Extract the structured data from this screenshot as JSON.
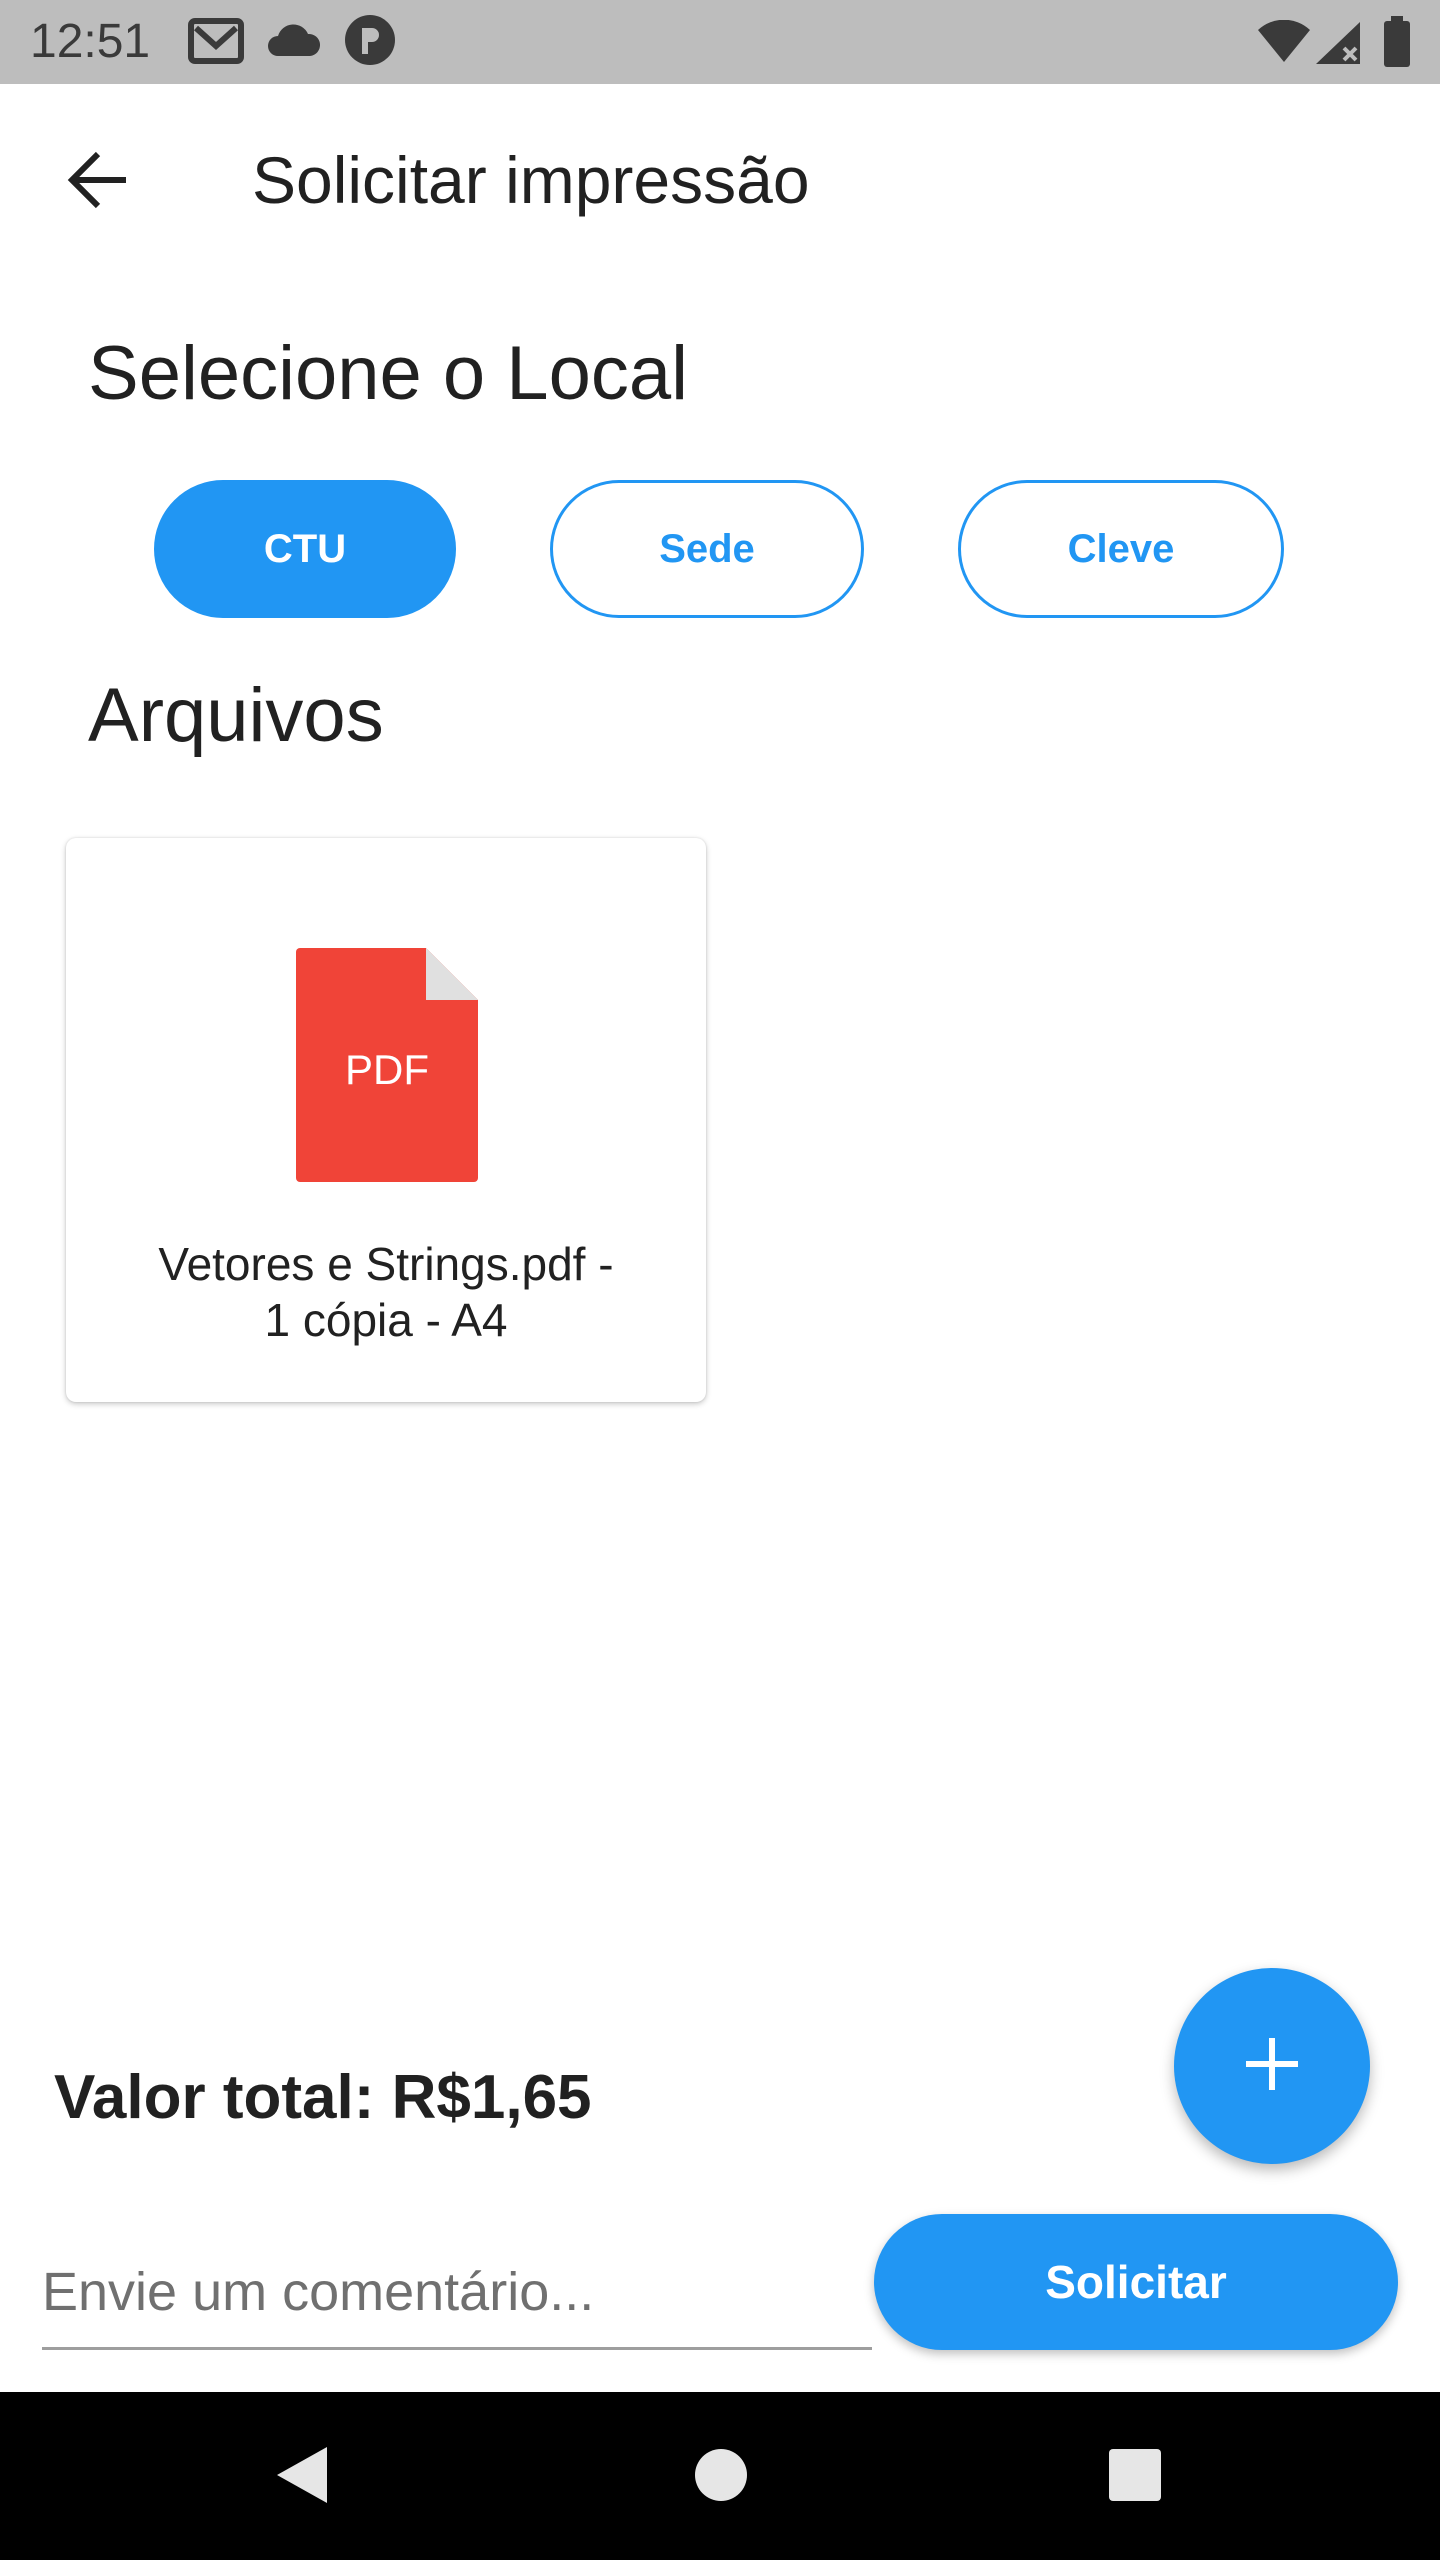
{
  "status_bar": {
    "time": "12:51",
    "left_icons": [
      "gmail-icon",
      "cloud-icon",
      "app-notification-icon"
    ],
    "right_icons": [
      "wifi-icon",
      "signal-icon",
      "battery-icon"
    ]
  },
  "app_bar": {
    "title": "Solicitar impressão",
    "back_icon": "arrow-back-icon"
  },
  "location": {
    "heading": "Selecione o Local",
    "options": [
      {
        "label": "CTU",
        "selected": true
      },
      {
        "label": "Sede",
        "selected": false
      },
      {
        "label": "Cleve",
        "selected": false
      }
    ]
  },
  "files": {
    "heading": "Arquivos",
    "items": [
      {
        "icon_label": "PDF",
        "caption_line1": "Vetores e Strings.pdf -",
        "caption_line2": "1 cópia - A4"
      }
    ]
  },
  "total": {
    "text": "Valor total: R$1,65"
  },
  "fab": {
    "icon": "plus-icon"
  },
  "comment": {
    "placeholder": "Envie um comentário...",
    "value": ""
  },
  "submit": {
    "label": "Solicitar"
  },
  "colors": {
    "primary": "#2196f3",
    "pdf_red": "#f04438",
    "status_bar": "#bdbdbd"
  }
}
